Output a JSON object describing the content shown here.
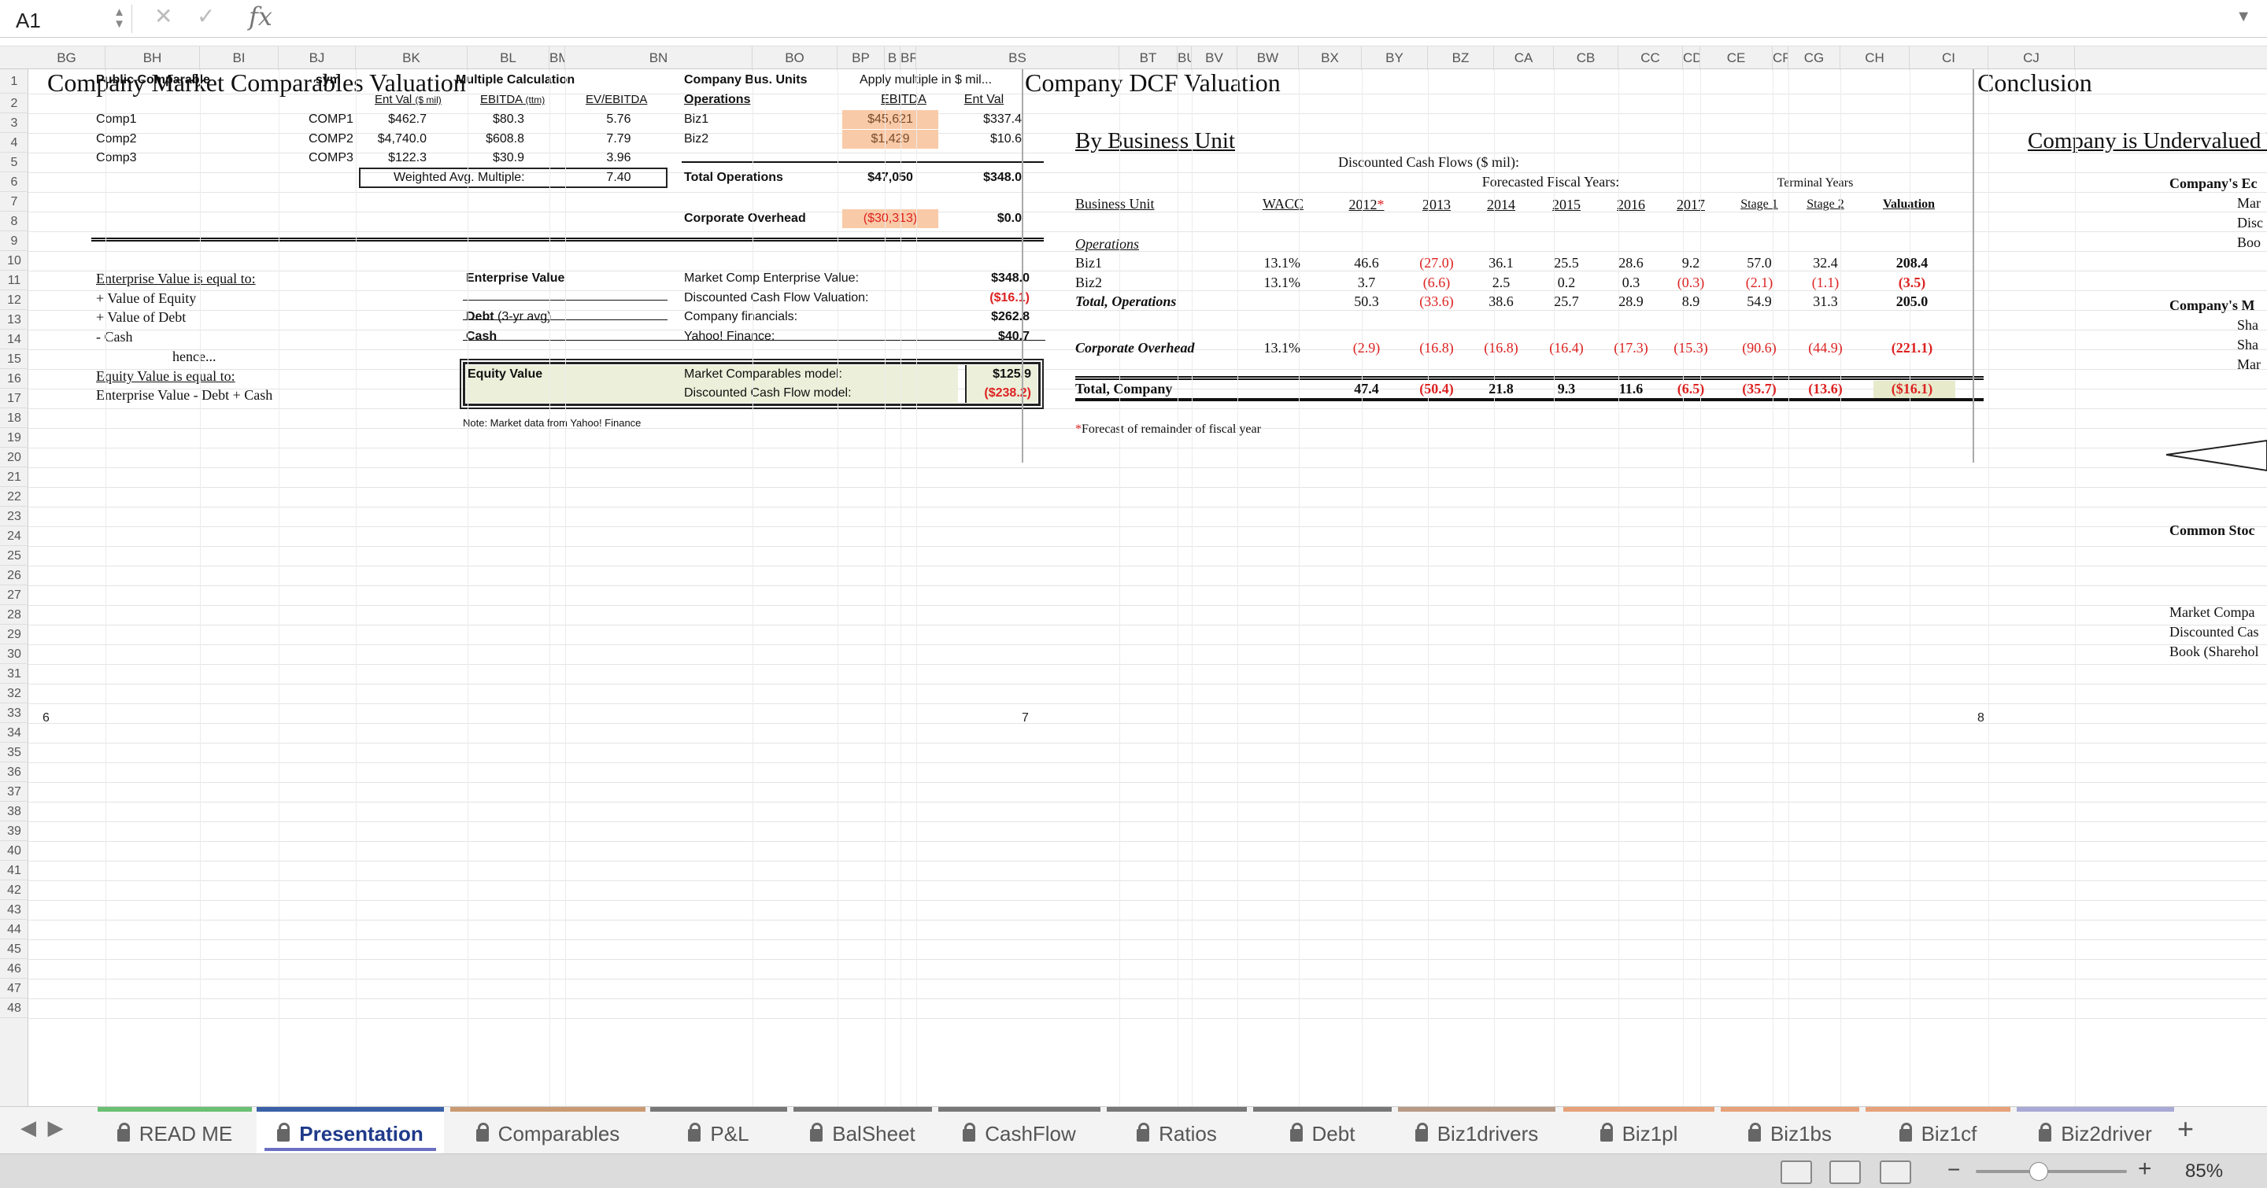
{
  "formula_bar": {
    "cell_ref": "A1",
    "fx_label": "fx",
    "formula": ""
  },
  "columns": [
    "BG",
    "BH",
    "BI",
    "BJ",
    "BK",
    "BL",
    "BM",
    "BN",
    "BO",
    "BP",
    "B",
    "BR",
    "BS",
    "BT",
    "BU",
    "BV",
    "BW",
    "BX",
    "BY",
    "BZ",
    "CA",
    "CB",
    "CC",
    "CD",
    "CE",
    "CF",
    "CG",
    "CH",
    "CI",
    "CJ"
  ],
  "rows": [
    "1",
    "2",
    "3",
    "4",
    "5",
    "6",
    "7",
    "8",
    "9",
    "10",
    "11",
    "12",
    "13",
    "14",
    "15",
    "16",
    "17",
    "18",
    "19",
    "20",
    "21",
    "22",
    "23",
    "24",
    "25",
    "26",
    "27",
    "28",
    "29",
    "30",
    "31",
    "32",
    "33",
    "34",
    "35",
    "36",
    "37",
    "38",
    "39",
    "40",
    "41",
    "42",
    "43",
    "44",
    "45",
    "46",
    "47",
    "48"
  ],
  "comps": {
    "title": "Company Market Comparables Valuation",
    "hdr_public": "Public Comparable",
    "hdr_sym": "sym",
    "hdr_multiple": "Multiple Calculation",
    "hdr_entval": "Ent Val",
    "hdr_entval_unit": "($ mil)",
    "hdr_ebitda": "EBITDA",
    "hdr_ebitda_unit": "(ttm)",
    "hdr_evebitda": "EV/EBITDA",
    "rows": [
      {
        "name": "Comp1",
        "sym": "COMP1",
        "ev": "$462.7",
        "ebitda": "$80.3",
        "mult": "5.76"
      },
      {
        "name": "Comp2",
        "sym": "COMP2",
        "ev": "$4,740.0",
        "ebitda": "$608.8",
        "mult": "7.79"
      },
      {
        "name": "Comp3",
        "sym": "COMP3",
        "ev": "$122.3",
        "ebitda": "$30.9",
        "mult": "3.96"
      }
    ],
    "wavg_label": "Weighted Avg. Multiple:",
    "wavg_value": "7.40",
    "bu_hdr1": "Company Bus. Units",
    "bu_hdr2": "Operations",
    "apply_hdr": "Apply multiple in $ mil...",
    "apply_ebitda": "EBITDA",
    "apply_entval": "Ent Val",
    "bu_rows": [
      {
        "name": "Biz1",
        "ebitda": "$45,621",
        "ev": "$337.4"
      },
      {
        "name": "Biz2",
        "ebitda": "$1,429",
        "ev": "$10.6"
      }
    ],
    "total_ops_label": "Total Operations",
    "total_ops_ebitda": "$47,050",
    "total_ops_ev": "$348.0",
    "corp_label": "Corporate Overhead",
    "corp_ebitda": "($30,313)",
    "corp_ev": "$0.0",
    "ev_text": [
      "Enterprise Value is equal to:",
      "+ Value of Equity",
      "+ Value of Debt",
      "-  Cash",
      "hence...",
      "Equity Value is equal to:",
      "Enterprise Value - Debt + Cash"
    ],
    "ev_label": "Enterprise Value",
    "debt_label": "Debt",
    "debt_sub": "(3-yr avg)",
    "cash_label": "Cash",
    "mc_ev_label": "Market Comp Enterprise Value:",
    "mc_ev_val": "$348.0",
    "dcf_val_label": "Discounted Cash Flow Valuation:",
    "dcf_val": "($16.1)",
    "co_fin_label": "Company financials:",
    "co_fin_val": "$262.8",
    "yahoo_label": "Yahoo! Finance:",
    "yahoo_val": "$40.7",
    "eq_label": "Equity Value",
    "mc_model_label": "Market Comparables model:",
    "mc_model_val": "$125.9",
    "dcf_model_label": "Discounted Cash Flow model:",
    "dcf_model_val": "($238.2)",
    "note": "Note: Market data from Yahoo! Finance",
    "page_num": "6"
  },
  "dcf": {
    "title": "Company DCF Valuation",
    "by_bu": "By Business Unit",
    "dcf_caption": "Discounted Cash Flows ($ mil):",
    "forecast_caption": "Forecasted Fiscal Years:",
    "terminal_caption": "Terminal Years",
    "bu_hdr": "Business Unit",
    "wacc_hdr": "WACC",
    "years": [
      "2012",
      "2013",
      "2014",
      "2015",
      "2016",
      "2017",
      "Stage 1",
      "Stage 2"
    ],
    "year_star": "*",
    "valuation_hdr": "Valuation",
    "ops_label": "Operations",
    "rows": [
      {
        "name": "Biz1",
        "wacc": "13.1%",
        "vals": [
          "46.6",
          "(27.0)",
          "36.1",
          "25.5",
          "28.6",
          "9.2",
          "57.0",
          "32.4"
        ],
        "val": "208.4"
      },
      {
        "name": "Biz2",
        "wacc": "13.1%",
        "vals": [
          "3.7",
          "(6.6)",
          "2.5",
          "0.2",
          "0.3",
          "(0.3)",
          "(2.1)",
          "(1.1)"
        ],
        "val": "(3.5)"
      },
      {
        "name": "Total, Operations",
        "wacc": "",
        "vals": [
          "50.3",
          "(33.6)",
          "38.6",
          "25.7",
          "28.9",
          "8.9",
          "54.9",
          "31.3"
        ],
        "val": "205.0"
      },
      {
        "name": "Corporate Overhead",
        "wacc": "13.1%",
        "vals": [
          "(2.9)",
          "(16.8)",
          "(16.8)",
          "(16.4)",
          "(17.3)",
          "(15.3)",
          "(90.6)",
          "(44.9)"
        ],
        "val": "(221.1)"
      },
      {
        "name": "Total, Company",
        "wacc": "",
        "vals": [
          "47.4",
          "(50.4)",
          "21.8",
          "9.3",
          "11.6",
          "(6.5)",
          "(35.7)",
          "(13.6)"
        ],
        "val": "($16.1)"
      }
    ],
    "footnote_star": "*",
    "footnote": "Forecast of remainder of fiscal year",
    "page_num": "7"
  },
  "conclusion": {
    "title": "Conclusion",
    "headline": "Company is Undervalued b",
    "eq_hdr": "Company's Ec",
    "eq_items": [
      "Mar",
      "Disc",
      "Boo"
    ],
    "mkt_hdr": "Company's M",
    "mkt_items": [
      "Sha",
      "Sha",
      "Mar"
    ],
    "common_stock": "Common Stoc",
    "chart_labels": [
      "Market Compa",
      "Discounted Cas",
      "Book (Sharehol"
    ],
    "page_num": "8"
  },
  "tabs": [
    {
      "label": "READ ME",
      "color": "#6bbf73"
    },
    {
      "label": "Presentation",
      "color": "#3a61a8"
    },
    {
      "label": "Comparables",
      "color": "#c99a72"
    },
    {
      "label": "P&L",
      "color": "#777"
    },
    {
      "label": "BalSheet",
      "color": "#777"
    },
    {
      "label": "CashFlow",
      "color": "#777"
    },
    {
      "label": "Ratios",
      "color": "#777"
    },
    {
      "label": "Debt",
      "color": "#777"
    },
    {
      "label": "Biz1drivers",
      "color": "#b79a86"
    },
    {
      "label": "Biz1pl",
      "color": "#e6a27a"
    },
    {
      "label": "Biz1bs",
      "color": "#e6a27a"
    },
    {
      "label": "Biz1cf",
      "color": "#e6a27a"
    },
    {
      "label": "Biz2driver",
      "color": "#a9a9d6"
    }
  ],
  "zoom": "85%"
}
